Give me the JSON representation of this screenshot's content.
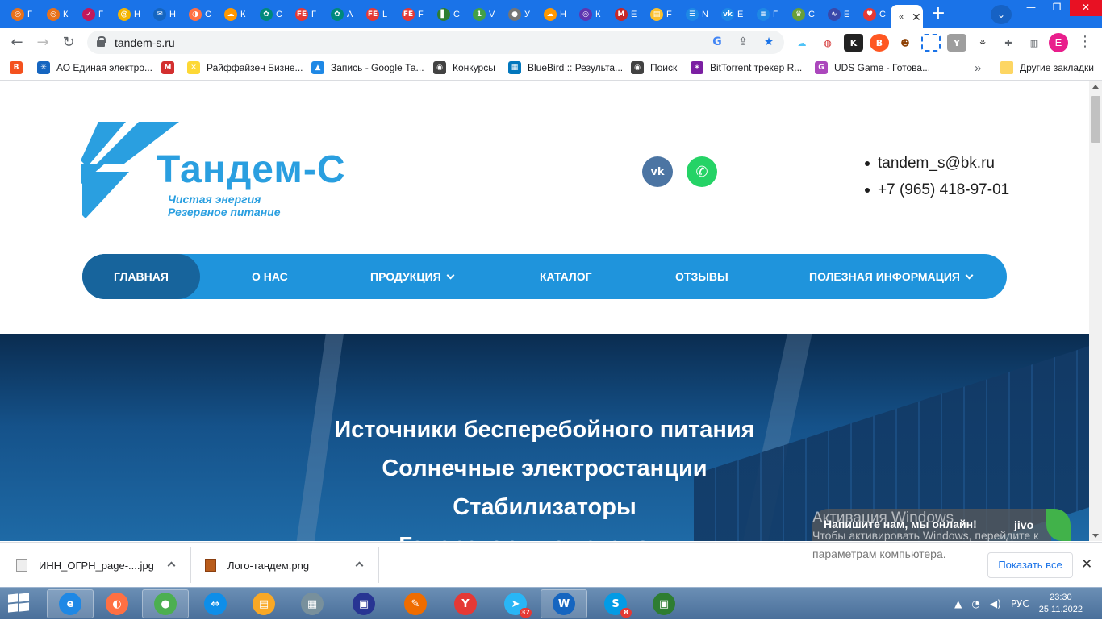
{
  "browser": {
    "tabs": [
      {
        "letter": "Г",
        "color": "#e8711a",
        "glyph": "◎"
      },
      {
        "letter": "К",
        "color": "#e8711a",
        "glyph": "◎"
      },
      {
        "letter": "Г",
        "color": "#c2185b",
        "glyph": "✓"
      },
      {
        "letter": "Н",
        "color": "#f4b400",
        "glyph": "@"
      },
      {
        "letter": "Н",
        "color": "#1565c0",
        "glyph": "✉"
      },
      {
        "letter": "С",
        "color": "#ff7043",
        "glyph": "◑"
      },
      {
        "letter": "К",
        "color": "#ff9800",
        "glyph": "☁"
      },
      {
        "letter": "С",
        "color": "#00897b",
        "glyph": "✿"
      },
      {
        "letter": "Г",
        "color": "#e53935",
        "glyph": "FE"
      },
      {
        "letter": "А",
        "color": "#00897b",
        "glyph": "✿"
      },
      {
        "letter": "L",
        "color": "#e53935",
        "glyph": "FE"
      },
      {
        "letter": "F",
        "color": "#e53935",
        "glyph": "FE"
      },
      {
        "letter": "С",
        "color": "#2e7d32",
        "glyph": "▌"
      },
      {
        "letter": "V",
        "color": "#43a047",
        "glyph": "1"
      },
      {
        "letter": "У",
        "color": "#757575",
        "glyph": "●"
      },
      {
        "letter": "Н",
        "color": "#ff9800",
        "glyph": "☁"
      },
      {
        "letter": "К",
        "color": "#5e35b1",
        "glyph": "◎"
      },
      {
        "letter": "Е",
        "color": "#c62828",
        "glyph": "M"
      },
      {
        "letter": "F",
        "color": "#fbc02d",
        "glyph": "▤"
      },
      {
        "letter": "N",
        "color": "#1e88e5",
        "glyph": "☰"
      },
      {
        "letter": "Е",
        "color": "#1e88e5",
        "glyph": "vk"
      },
      {
        "letter": "Г",
        "color": "#1e88e5",
        "glyph": "≡"
      },
      {
        "letter": "С",
        "color": "#689f38",
        "glyph": "♛"
      },
      {
        "letter": "Е",
        "color": "#3949ab",
        "glyph": "∿"
      },
      {
        "letter": "С",
        "color": "#e53935",
        "glyph": "♥"
      }
    ],
    "active_tab": {
      "letter": "«",
      "glyph": "«"
    },
    "url": "tandem-s.ru",
    "profile_initial": "E",
    "bookmarks": [
      {
        "label": "",
        "color": "#f4511e",
        "glyph": "B"
      },
      {
        "label": "АО Единая электро...",
        "color": "#1565c0",
        "glyph": "✳"
      },
      {
        "label": "",
        "color": "#d32f2f",
        "glyph": "M"
      },
      {
        "label": "Райффайзен Бизне...",
        "color": "#fdd835",
        "glyph": "✕"
      },
      {
        "label": "Запись - Google Та...",
        "color": "#1e88e5",
        "glyph": "▲"
      },
      {
        "label": "Конкурсы",
        "color": "#424242",
        "glyph": "◉"
      },
      {
        "label": "BlueBird :: Результа...",
        "color": "#0277bd",
        "glyph": "▦"
      },
      {
        "label": "Поиск",
        "color": "#424242",
        "glyph": "◉"
      },
      {
        "label": "BitTorrent трекер R...",
        "color": "#7b1fa2",
        "glyph": "✶"
      },
      {
        "label": "UDS Game - Готова...",
        "color": "#ab47bc",
        "glyph": "G"
      }
    ],
    "bookmarks_more": "»",
    "other_bookmarks": "Другие закладки"
  },
  "site": {
    "logo": {
      "name": "Тандем-С",
      "line1": "Чистая энергия",
      "line2": "Резервное питание"
    },
    "social": {
      "vk": "vk",
      "whatsapp": "✆"
    },
    "contacts": {
      "email": "tandem_s@bk.ru",
      "phone": "+7 (965) 418-97-01"
    },
    "nav": [
      {
        "label": "Главная",
        "active": true
      },
      {
        "label": "О нас"
      },
      {
        "label": "Продукция",
        "dropdown": true
      },
      {
        "label": "Каталог"
      },
      {
        "label": "Отзывы"
      },
      {
        "label": "Полезная информация",
        "dropdown": true
      }
    ],
    "hero": [
      "Источники бесперебойного питания",
      "Солнечные электростанции",
      "Стабилизаторы",
      "Генераторные установки"
    ]
  },
  "overlays": {
    "activation_title": "Активация Windows",
    "activation_line1": "Чтобы активировать Windows, перейдите к",
    "activation_line2": "параметрам компьютера.",
    "jivo_text": "Напишите нам, мы онлайн!",
    "jivo_brand": "jivo"
  },
  "downloads": {
    "items": [
      {
        "name": "ИНН_ОГРН_page-....jpg",
        "type": "jpg"
      },
      {
        "name": "Лого-тандем.png",
        "type": "png"
      }
    ],
    "show_all": "Показать все",
    "close": "✕"
  },
  "taskbar": {
    "apps": [
      {
        "name": "internet-explorer",
        "glyph": "e",
        "color": "#1e88e5",
        "running": true
      },
      {
        "name": "firefox",
        "glyph": "◐",
        "color": "#ff7043"
      },
      {
        "name": "chrome",
        "glyph": "●",
        "color": "#4caf50",
        "running": true
      },
      {
        "name": "teamviewer",
        "glyph": "⇔",
        "color": "#0e8ee9"
      },
      {
        "name": "file-explorer",
        "glyph": "▤",
        "color": "#f9a825"
      },
      {
        "name": "calculator",
        "glyph": "▦",
        "color": "#78909c"
      },
      {
        "name": "save-app",
        "glyph": "▣",
        "color": "#283593"
      },
      {
        "name": "paint",
        "glyph": "✎",
        "color": "#ef6c00"
      },
      {
        "name": "yandex-browser",
        "glyph": "Y",
        "color": "#e53935"
      },
      {
        "name": "telegram",
        "glyph": "➤",
        "color": "#29b6f6",
        "badge": "37"
      },
      {
        "name": "word",
        "glyph": "W",
        "color": "#1565c0",
        "running": true
      },
      {
        "name": "skype",
        "glyph": "S",
        "color": "#039be5",
        "badge": "8"
      },
      {
        "name": "green-app",
        "glyph": "▣",
        "color": "#2e7d32"
      }
    ],
    "tray": {
      "lang": "РУС",
      "time": "23:30",
      "date": "25.11.2022"
    }
  },
  "colors": {
    "brand": "#2a9fe0",
    "nav": "#1f94dc",
    "nav_active": "#17649c",
    "chrome_blue": "#1a73e8"
  }
}
